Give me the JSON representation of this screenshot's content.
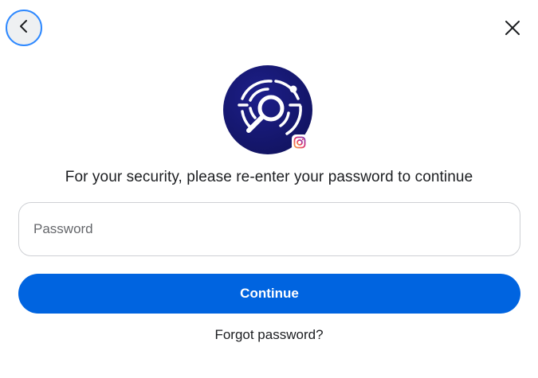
{
  "header": {
    "back_icon": "chevron-left-icon",
    "close_icon": "close-icon"
  },
  "logo": {
    "icon": "security-scan-icon",
    "badge_icon": "instagram-icon",
    "background_color": "#15176e"
  },
  "heading": "For your security, please re-enter your password to continue",
  "password": {
    "placeholder": "Password",
    "value": ""
  },
  "continue_label": "Continue",
  "forgot_label": "Forgot password?",
  "colors": {
    "accent": "#0064e0",
    "focus_ring": "#2d88ff"
  }
}
